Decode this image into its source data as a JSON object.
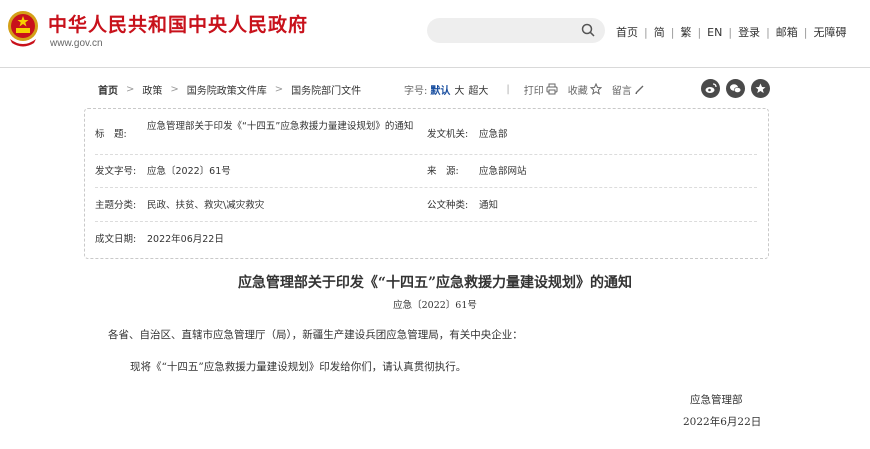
{
  "header": {
    "site_title": "中华人民共和国中央人民政府",
    "site_url": "www.gov.cn",
    "nav": [
      "首页",
      "简",
      "繁",
      "EN",
      "登录",
      "邮箱",
      "无障碍"
    ]
  },
  "breadcrumb": [
    "首页",
    "政策",
    "国务院政策文件库",
    "国务院部门文件"
  ],
  "toolbar": {
    "font_label": "字号:",
    "font_sizes": [
      "默认",
      "大",
      "超大"
    ],
    "print": "打印",
    "favorite": "收藏",
    "comment": "留言"
  },
  "info": {
    "title_label": "标　题:",
    "title_value": "应急管理部关于印发《“十四五”应急救援力量建设规划》的通知",
    "issuer_label": "发文机关:",
    "issuer_value": "应急部",
    "docno_label": "发文字号:",
    "docno_value": "应急〔2022〕61号",
    "source_label": "来　源:",
    "source_value": "应急部网站",
    "topic_label": "主题分类:",
    "topic_value": "民政、扶贫、救灾\\减灾救灾",
    "type_label": "公文种类:",
    "type_value": "通知",
    "date_label": "成文日期:",
    "date_value": "2022年06月22日"
  },
  "article": {
    "title": "应急管理部关于印发《“十四五”应急救援力量建设规划》的通知",
    "docno": "应急〔2022〕61号",
    "salutation": "各省、自治区、直辖市应急管理厅（局），新疆生产建设兵团应急管理局，有关中央企业：",
    "body": "现将《“十四五”应急救援力量建设规划》印发给你们，请认真贯彻执行。",
    "signature": "应急管理部",
    "sign_date": "2022年6月22日"
  },
  "colors": {
    "brand_red": "#c8111b",
    "font_active": "#1a4fa0"
  }
}
